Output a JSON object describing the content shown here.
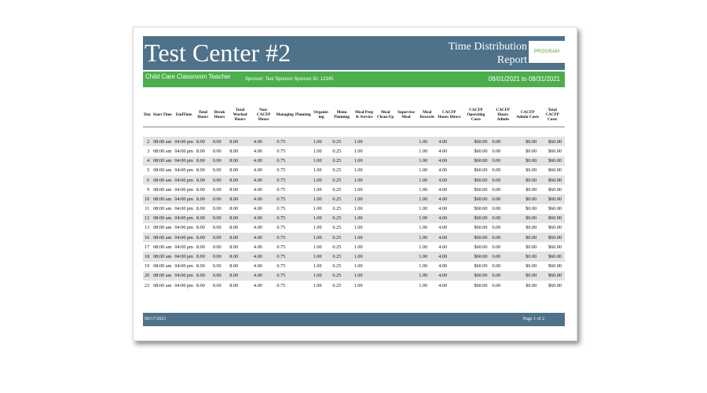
{
  "report": {
    "center_name": "Test Center #2",
    "report_title_line1": "Time Distribution",
    "report_title_line2": "Report",
    "logo_text": "PROGRAM",
    "program": "Child Care Classroom Teacher",
    "sponsor": "Sponsor: Test Sponsor    Sponsor ID: 12345",
    "date_range": "08/01/2021  to  08/31/2021"
  },
  "table": {
    "headers": [
      "Day",
      "Start Time",
      "EndTime",
      "Total Hours",
      "Break Hours",
      "Total Worked Hours",
      "Non-CACFP Hours",
      "Managing",
      "Planning",
      "Organiz-ing",
      "Menu Planning",
      "Meal Prep & Service",
      "Meal Clean-Up",
      "Supervise Meal",
      "Meal Records",
      "CACFP Hours Direct",
      "CACFP Operating Costs",
      "CACFP Hours Admin",
      "CACFP Admin Costs",
      "Total CACFP Costs"
    ],
    "rows": [
      [
        "2",
        "08:00 am",
        "04:00 pm",
        "8.00",
        "0.00",
        "8.00",
        "4.00",
        "0.75",
        "",
        "1.00",
        "0.25",
        "1.00",
        "",
        "",
        "1.00",
        "4.00",
        "$60.00",
        "0.00",
        "$0.00",
        "$60.00"
      ],
      [
        "3",
        "08:00 am",
        "04:00 pm",
        "8.00",
        "0.00",
        "8.00",
        "4.00",
        "0.75",
        "",
        "1.00",
        "0.25",
        "1.00",
        "",
        "",
        "1.00",
        "4.00",
        "$60.00",
        "0.00",
        "$0.00",
        "$60.00"
      ],
      [
        "4",
        "08:00 am",
        "04:00 pm",
        "8.00",
        "0.00",
        "8.00",
        "4.00",
        "0.75",
        "",
        "1.00",
        "0.25",
        "1.00",
        "",
        "",
        "1.00",
        "4.00",
        "$60.00",
        "0.00",
        "$0.00",
        "$60.00"
      ],
      [
        "5",
        "08:00 am",
        "04:00 pm",
        "8.00",
        "0.00",
        "8.00",
        "4.00",
        "0.75",
        "",
        "1.00",
        "0.25",
        "1.00",
        "",
        "",
        "1.00",
        "4.00",
        "$60.00",
        "0.00",
        "$0.00",
        "$60.00"
      ],
      [
        "6",
        "08:00 am",
        "04:00 pm",
        "8.00",
        "0.00",
        "8.00",
        "4.00",
        "0.75",
        "",
        "1.00",
        "0.25",
        "1.00",
        "",
        "",
        "1.00",
        "4.00",
        "$60.00",
        "0.00",
        "$0.00",
        "$60.00"
      ],
      [
        "9",
        "08:00 am",
        "04:00 pm",
        "8.00",
        "0.00",
        "8.00",
        "4.00",
        "0.75",
        "",
        "1.00",
        "0.25",
        "1.00",
        "",
        "",
        "1.00",
        "4.00",
        "$60.00",
        "0.00",
        "$0.00",
        "$60.00"
      ],
      [
        "10",
        "08:00 am",
        "04:00 pm",
        "8.00",
        "0.00",
        "8.00",
        "4.00",
        "0.75",
        "",
        "1.00",
        "0.25",
        "1.00",
        "",
        "",
        "1.00",
        "4.00",
        "$60.00",
        "0.00",
        "$0.00",
        "$60.00"
      ],
      [
        "11",
        "08:00 am",
        "04:00 pm",
        "8.00",
        "0.00",
        "8.00",
        "4.00",
        "0.75",
        "",
        "1.00",
        "0.25",
        "1.00",
        "",
        "",
        "1.00",
        "4.00",
        "$60.00",
        "0.00",
        "$0.00",
        "$60.00"
      ],
      [
        "12",
        "08:00 am",
        "04:00 pm",
        "8.00",
        "0.00",
        "8.00",
        "4.00",
        "0.75",
        "",
        "1.00",
        "0.25",
        "1.00",
        "",
        "",
        "1.00",
        "4.00",
        "$60.00",
        "0.00",
        "$0.00",
        "$60.00"
      ],
      [
        "13",
        "08:00 am",
        "04:00 pm",
        "8.00",
        "0.00",
        "8.00",
        "4.00",
        "0.75",
        "",
        "1.00",
        "0.25",
        "1.00",
        "",
        "",
        "1.00",
        "4.00",
        "$60.00",
        "0.00",
        "$0.00",
        "$60.00"
      ],
      [
        "16",
        "08:00 am",
        "04:00 pm",
        "8.00",
        "0.00",
        "8.00",
        "4.00",
        "0.75",
        "",
        "1.00",
        "0.25",
        "1.00",
        "",
        "",
        "1.00",
        "4.00",
        "$60.00",
        "0.00",
        "$0.00",
        "$60.00"
      ],
      [
        "17",
        "08:00 am",
        "04:00 pm",
        "8.00",
        "0.00",
        "8.00",
        "4.00",
        "0.75",
        "",
        "1.00",
        "0.25",
        "1.00",
        "",
        "",
        "1.00",
        "4.00",
        "$60.00",
        "0.00",
        "$0.00",
        "$60.00"
      ],
      [
        "18",
        "08:00 am",
        "04:00 pm",
        "8.00",
        "0.00",
        "8.00",
        "4.00",
        "0.75",
        "",
        "1.00",
        "0.25",
        "1.00",
        "",
        "",
        "1.00",
        "4.00",
        "$60.00",
        "0.00",
        "$0.00",
        "$60.00"
      ],
      [
        "19",
        "08:00 am",
        "04:00 pm",
        "8.00",
        "0.00",
        "8.00",
        "4.00",
        "0.75",
        "",
        "1.00",
        "0.25",
        "1.00",
        "",
        "",
        "1.00",
        "4.00",
        "$60.00",
        "0.00",
        "$0.00",
        "$60.00"
      ],
      [
        "20",
        "08:00 am",
        "04:00 pm",
        "8.00",
        "0.00",
        "8.00",
        "4.00",
        "0.75",
        "",
        "1.00",
        "0.25",
        "1.00",
        "",
        "",
        "1.00",
        "4.00",
        "$60.00",
        "0.00",
        "$0.00",
        "$60.00"
      ],
      [
        "23",
        "08:00 am",
        "04:00 pm",
        "8.00",
        "0.00",
        "8.00",
        "4.00",
        "0.75",
        "",
        "1.00",
        "0.25",
        "1.00",
        "",
        "",
        "1.00",
        "4.00",
        "$60.00",
        "0.00",
        "$0.00",
        "$60.00"
      ]
    ]
  },
  "footer": {
    "print_date": "09/17/2021",
    "page": "Page 1 of 2"
  },
  "colors": {
    "header_band": "#4f718a",
    "green_band": "#4cae4c",
    "row_stripe": "#e3e3e3"
  }
}
